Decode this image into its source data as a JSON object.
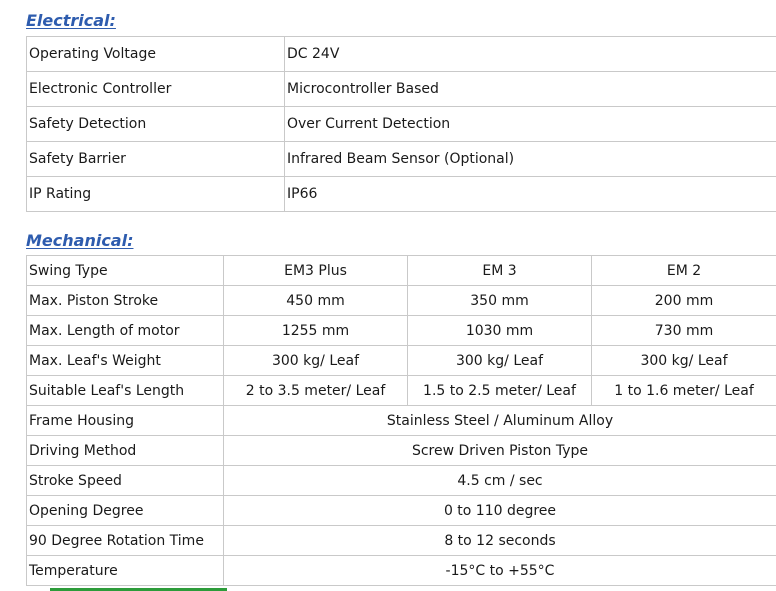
{
  "electrical": {
    "heading": "Electrical:",
    "rows": [
      {
        "label": "Operating Voltage",
        "value": "DC 24V"
      },
      {
        "label": "Electronic Controller",
        "value": "Microcontroller Based"
      },
      {
        "label": "Safety Detection",
        "value": "Over Current Detection"
      },
      {
        "label": "Safety Barrier",
        "value": "Infrared Beam Sensor (Optional)"
      },
      {
        "label": "IP Rating",
        "value": "IP66"
      }
    ]
  },
  "mechanical": {
    "heading": "Mechanical:",
    "header": {
      "label": "Swing Type",
      "models": [
        "EM3 Plus",
        "EM 3",
        "EM 2"
      ]
    },
    "model_rows": [
      {
        "label": "Max. Piston Stroke",
        "values": [
          "450 mm",
          "350 mm",
          "200 mm"
        ]
      },
      {
        "label": "Max. Length of motor",
        "values": [
          "1255 mm",
          "1030 mm",
          "730 mm"
        ]
      },
      {
        "label": "Max. Leaf's Weight",
        "values": [
          "300 kg/ Leaf",
          "300 kg/ Leaf",
          "300 kg/ Leaf"
        ]
      },
      {
        "label": "Suitable Leaf's Length",
        "values": [
          "2 to 3.5 meter/ Leaf",
          "1.5 to 2.5 meter/ Leaf",
          "1 to 1.6 meter/ Leaf"
        ]
      }
    ],
    "shared_rows": [
      {
        "label": "Frame Housing",
        "value": "Stainless Steel / Aluminum Alloy"
      },
      {
        "label": "Driving Method",
        "value": "Screw Driven Piston Type"
      },
      {
        "label": "Stroke Speed",
        "value": "4.5 cm / sec"
      },
      {
        "label": "Opening Degree",
        "value": "0 to 110 degree"
      },
      {
        "label": "90 Degree Rotation Time",
        "value": "8 to 12 seconds"
      },
      {
        "label": "Temperature",
        "value": "-15°C to +55°C"
      }
    ]
  },
  "colors": {
    "heading": "#2e5cae",
    "border": "#c9c9c9",
    "accent_line": "#2c9c3a"
  }
}
